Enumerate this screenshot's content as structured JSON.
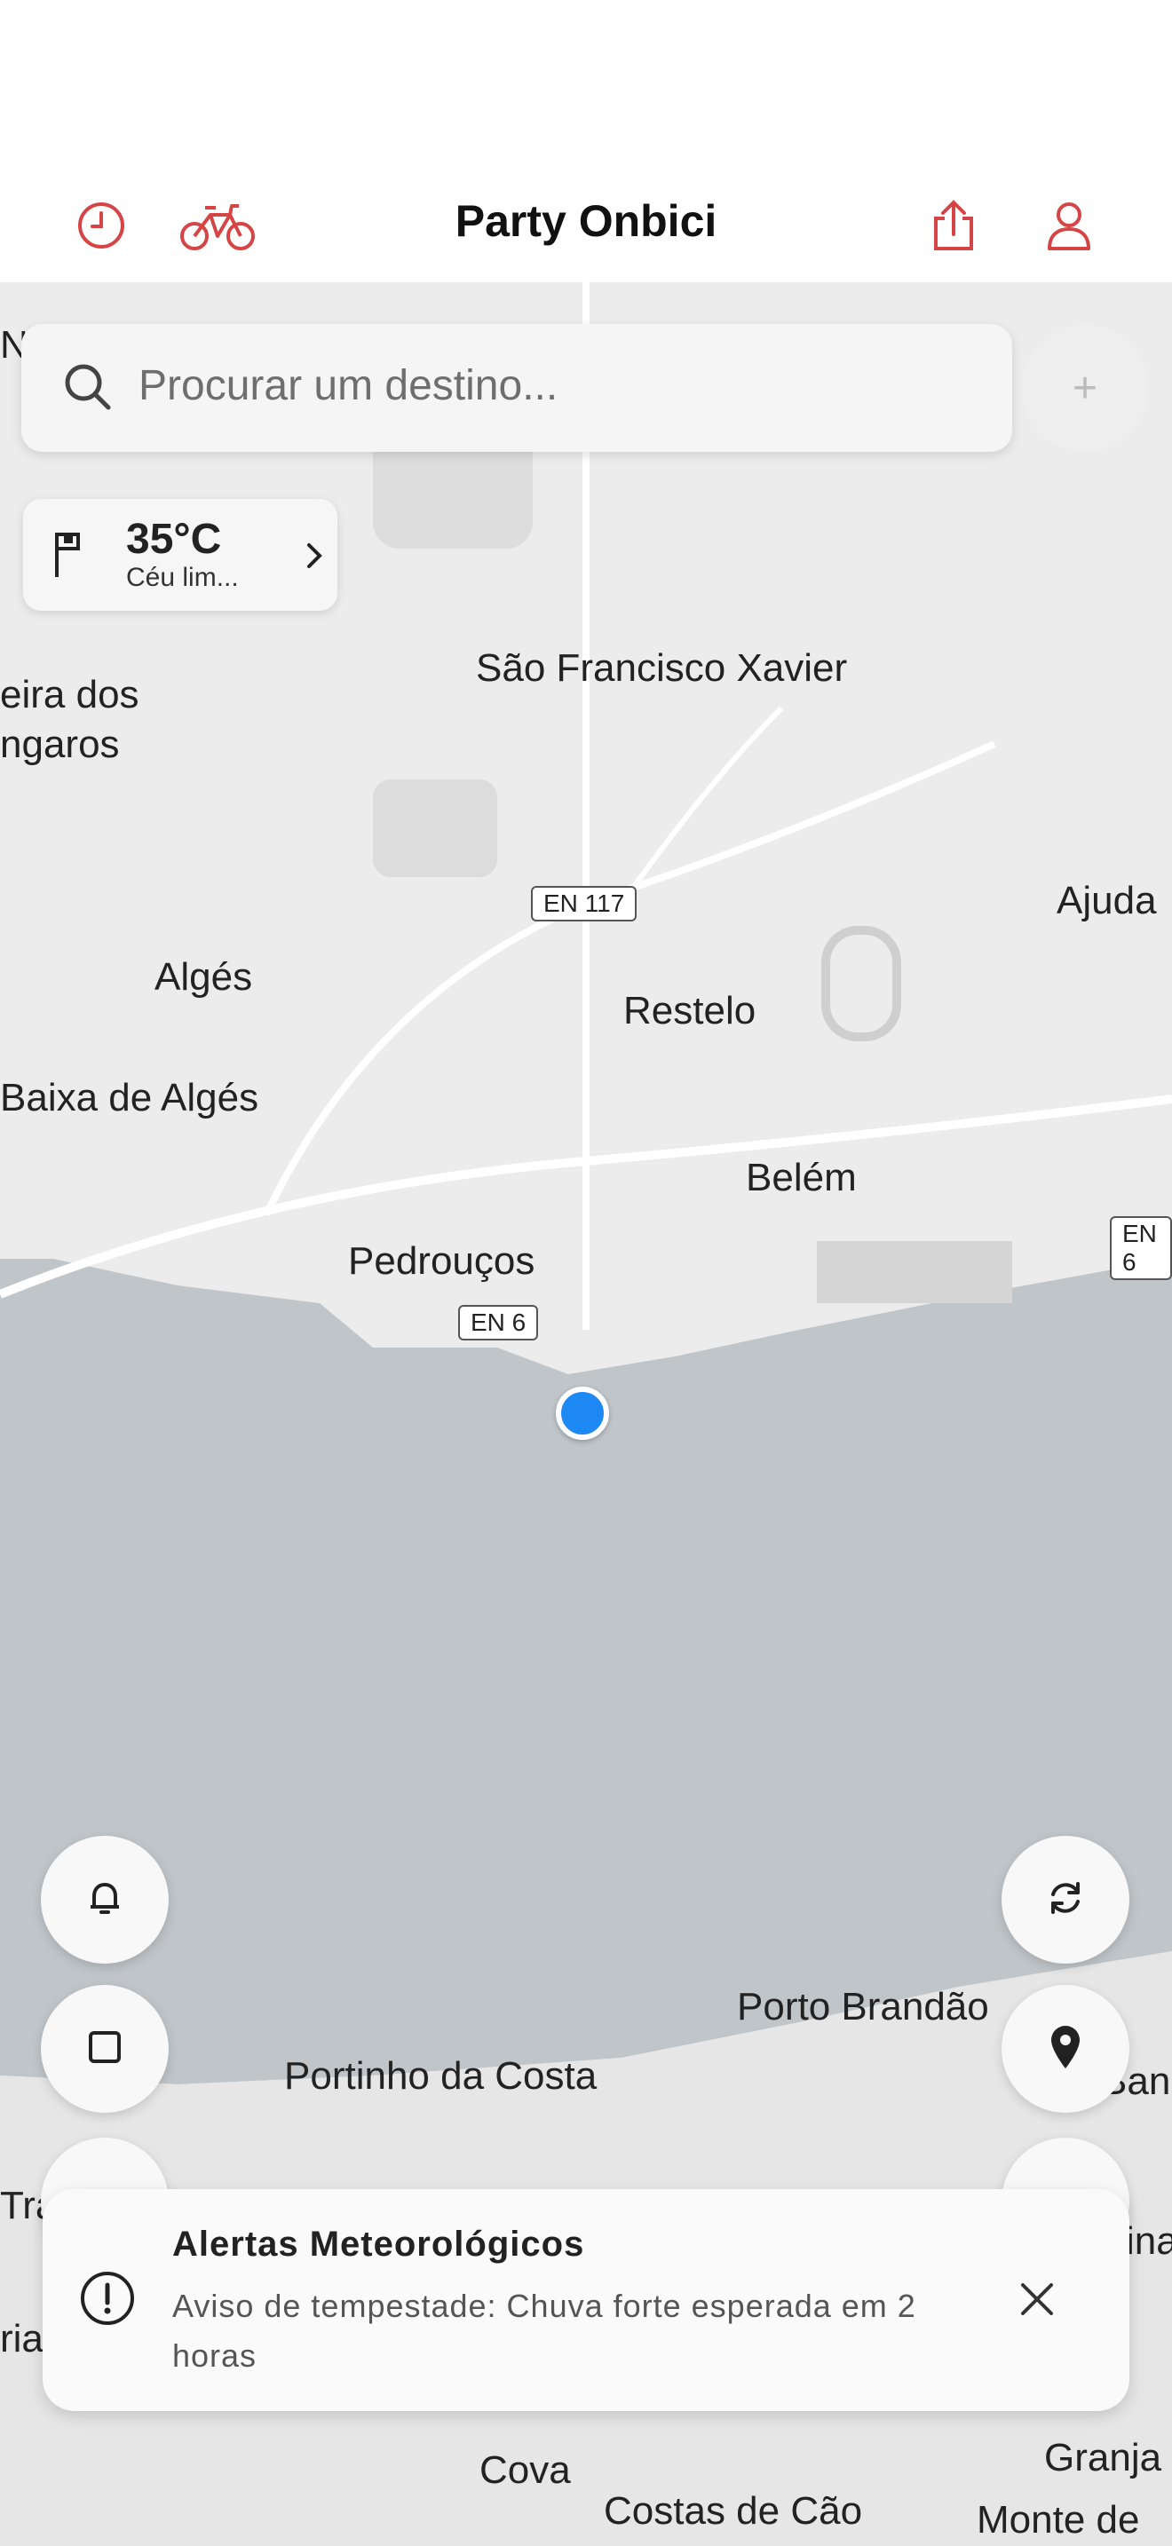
{
  "app": {
    "title": "Party Onbici"
  },
  "header": {
    "icons": [
      "history-icon",
      "bike-icon",
      "share-icon",
      "profile-icon"
    ],
    "accent": "#d64545"
  },
  "search": {
    "placeholder": "Procurar um destino..."
  },
  "map_controls": {
    "zoom_in": "+"
  },
  "weather": {
    "temp": "35°C",
    "condition": "Céu lim..."
  },
  "map": {
    "places": [
      "No",
      "eira dos",
      "ngaros",
      "São Francisco Xavier",
      "Ajuda",
      "Algés",
      "Restelo",
      "Baixa de Algés",
      "Belém",
      "Pedrouços",
      "Porto Brandão",
      "Portinho da Costa",
      "Ban",
      "Tra",
      "ina",
      "ria",
      "Cova",
      "Costas de Cão",
      "Granja",
      "Monte de"
    ],
    "roads": [
      "EN 117",
      "EN 6",
      "EN 6"
    ],
    "water_color": "#bfc5c9",
    "land_color": "#ececec"
  },
  "alert": {
    "title": "Alertas Meteorológicos",
    "message": "Aviso de tempestade: Chuva forte esperada em 2 horas"
  },
  "colors": {
    "location": "#1e88f5",
    "text": "#222222"
  }
}
